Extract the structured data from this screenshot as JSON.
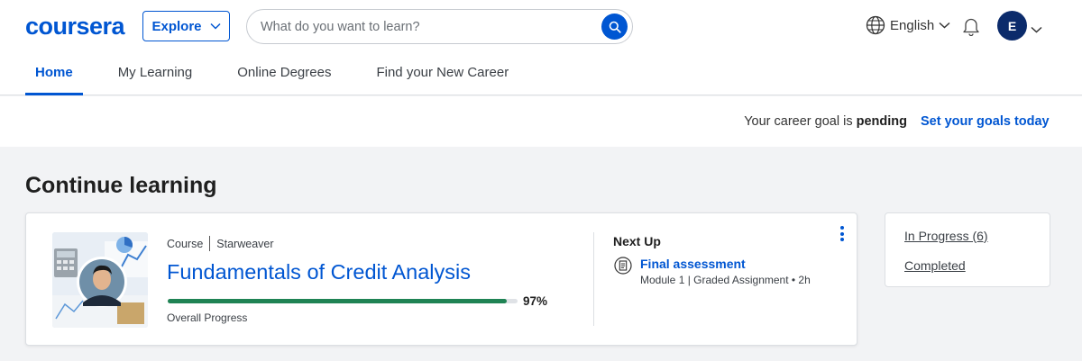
{
  "header": {
    "logo": "coursera",
    "explore_label": "Explore",
    "search": {
      "placeholder": "What do you want to learn?",
      "value": ""
    },
    "language_label": "English",
    "avatar_initial": "E"
  },
  "nav": {
    "tabs": [
      {
        "label": "Home",
        "active": true
      },
      {
        "label": "My Learning",
        "active": false
      },
      {
        "label": "Online Degrees",
        "active": false
      },
      {
        "label": "Find your New Career",
        "active": false
      }
    ]
  },
  "goal_bar": {
    "prefix": "Your career goal is",
    "status": "pending",
    "link_label": "Set your goals today"
  },
  "continue_learning": {
    "title": "Continue learning",
    "course": {
      "type": "Course",
      "provider": "Starweaver",
      "title": "Fundamentals of Credit Analysis",
      "progress_percent": 97,
      "progress_text": "97%",
      "progress_label": "Overall Progress",
      "next_up_label": "Next Up",
      "next_item_title": "Final assessment",
      "next_item_meta": "Module 1 | Graded Assignment • 2h"
    },
    "status_links": {
      "in_progress": "In Progress (6)",
      "completed": "Completed"
    }
  },
  "colors": {
    "brand": "#0056d2",
    "progress": "#1f8354",
    "avatar_bg": "#0b2b6b"
  },
  "icons": [
    "chevron-down-icon",
    "search-icon",
    "globe-icon",
    "bell-icon",
    "document-icon",
    "more-vertical-icon"
  ]
}
